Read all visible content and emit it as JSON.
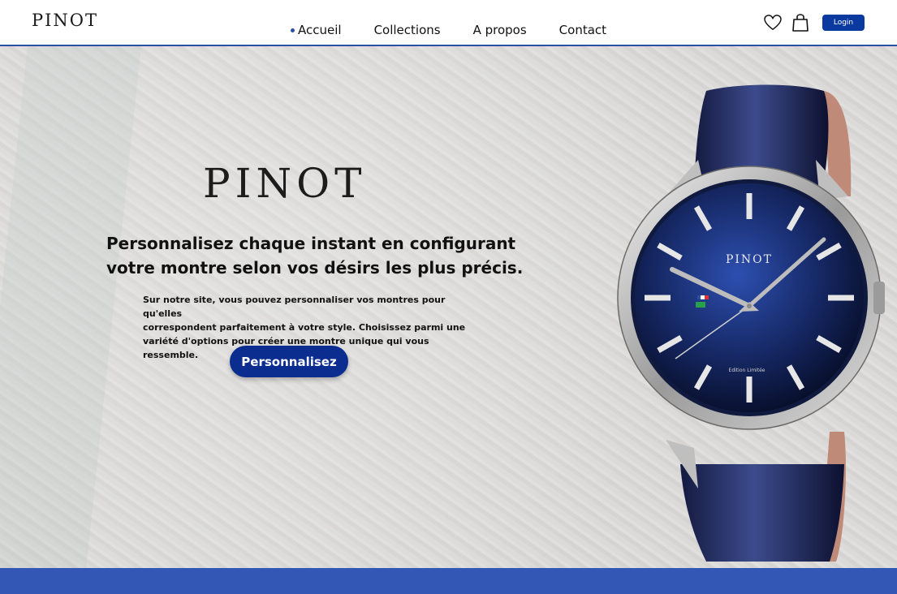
{
  "brand": {
    "name": "PINOT"
  },
  "nav": {
    "items": [
      {
        "label": "Accueil",
        "active": true
      },
      {
        "label": "Collections",
        "active": false
      },
      {
        "label": "A propos",
        "active": false
      },
      {
        "label": "Contact",
        "active": false
      }
    ]
  },
  "header": {
    "icons": [
      "heart-icon",
      "shopping-bag-icon"
    ],
    "login_label": "Login"
  },
  "hero": {
    "logo_text": "PINOT",
    "title_line1": "Personnalisez chaque instant en configurant",
    "title_line2": "votre montre selon vos désirs les plus précis.",
    "desc_line1": "Sur notre site, vous pouvez personnaliser vos montres pour qu'elles",
    "desc_line2": "correspondent parfaitement à votre style. Choisissez parmi une",
    "desc_line3": "variété d'options pour créer une montre unique qui vous ressemble.",
    "cta_label": "Personnalisez"
  },
  "watch": {
    "dial_brand": "PINOT",
    "edition_text": "Edition Limitée"
  },
  "colors": {
    "accent": "#2c4fa6",
    "button": "#0a2d8f",
    "footer_band": "#3257b5"
  }
}
